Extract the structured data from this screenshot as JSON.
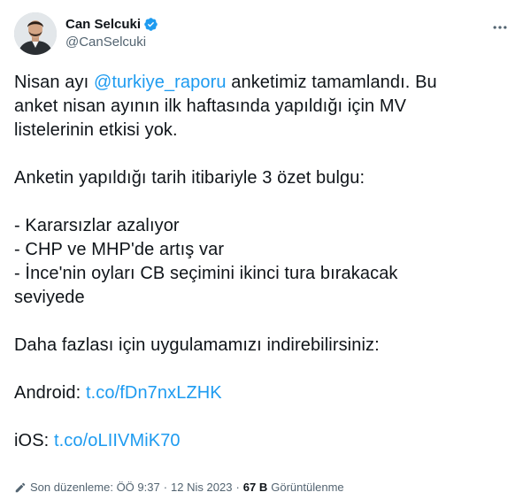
{
  "tweet": {
    "author": {
      "display_name": "Can Selcuki",
      "handle": "@CanSelcuki",
      "verified": true
    },
    "more_icon": "more-horizontal-icon",
    "text": {
      "l1_pre": "Nisan ayı ",
      "l1_mention": "@turkiye_raporu",
      "l1_post": " anketimiz tamamlandı. Bu",
      "l2": "anket nisan ayının ilk haftasında yapıldığı için MV",
      "l3": "listelerinin etkisi yok.",
      "l4": "Anketin yapıldığı tarih itibariyle 3 özet bulgu:",
      "l5": "- Kararsızlar azalıyor",
      "l6": "- CHP ve MHP'de artış var",
      "l7": "- İnce'nin oyları CB seçimini ikinci tura bırakacak",
      "l8": "seviyede",
      "l9": "Daha fazlası için uygulamamızı indirebilirsiniz:",
      "android_label": "Android: ",
      "android_link": "t.co/fDn7nxLZHK",
      "ios_label": "iOS: ",
      "ios_link": "t.co/oLIIVMiK70"
    },
    "meta": {
      "edited_label": "Son düzenleme: ÖÖ 9:37",
      "separator": "·",
      "date": "12 Nis 2023",
      "views_count": "67 B",
      "views_label": "Görüntülenme"
    },
    "colors": {
      "link": "#1d9bf0",
      "text": "#0f1419",
      "secondary": "#536471"
    }
  }
}
